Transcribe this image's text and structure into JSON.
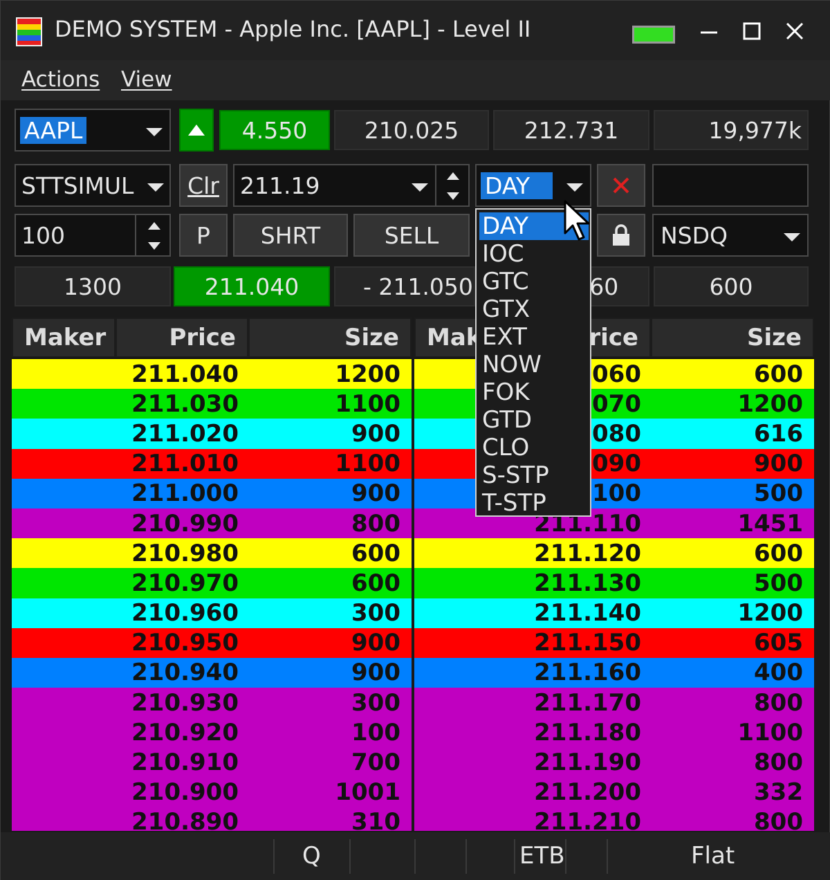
{
  "window": {
    "title": "DEMO SYSTEM - Apple Inc. [AAPL] - Level II"
  },
  "menu": {
    "actions": "Actions",
    "view": "View"
  },
  "row1": {
    "symbol": "AAPL",
    "change": "4.550",
    "bid_price": "210.025",
    "ask_price": "212.731",
    "volume": "19,977k"
  },
  "row2": {
    "account": "STTSIMUL",
    "clr_label": "Clr",
    "price": "211.19",
    "tif": "DAY"
  },
  "row3": {
    "quantity": "100",
    "p_label": "P",
    "short_label": "SHRT",
    "sell_label": "SELL",
    "route": "NSDQ"
  },
  "row4": {
    "bid_size": "1300",
    "bid": "211.040",
    "spread": "- 211.050",
    "ask": "211.060",
    "ask_size": "600"
  },
  "tif_options": [
    "DAY",
    "IOC",
    "GTC",
    "GTX",
    "EXT",
    "NOW",
    "FOK",
    "GTD",
    "CLO",
    "S-STP",
    "T-STP"
  ],
  "bid_table": {
    "headers": {
      "maker": "Maker",
      "price": "Price",
      "size": "Size"
    },
    "rows": [
      {
        "price": "211.040",
        "size": "1200",
        "color": "#ffff00"
      },
      {
        "price": "211.030",
        "size": "1100",
        "color": "#00e600"
      },
      {
        "price": "211.020",
        "size": "900",
        "color": "#00ffff"
      },
      {
        "price": "211.010",
        "size": "1100",
        "color": "#ff0000"
      },
      {
        "price": "211.000",
        "size": "900",
        "color": "#0080ff"
      },
      {
        "price": "210.990",
        "size": "800",
        "color": "#c000c0"
      },
      {
        "price": "210.980",
        "size": "600",
        "color": "#ffff00"
      },
      {
        "price": "210.970",
        "size": "600",
        "color": "#00e600"
      },
      {
        "price": "210.960",
        "size": "300",
        "color": "#00ffff"
      },
      {
        "price": "210.950",
        "size": "900",
        "color": "#ff0000"
      },
      {
        "price": "210.940",
        "size": "900",
        "color": "#0080ff"
      },
      {
        "price": "210.930",
        "size": "300",
        "color": "#c000c0"
      },
      {
        "price": "210.920",
        "size": "100",
        "color": "#c000c0"
      },
      {
        "price": "210.910",
        "size": "700",
        "color": "#c000c0"
      },
      {
        "price": "210.900",
        "size": "1001",
        "color": "#c000c0"
      },
      {
        "price": "210.890",
        "size": "310",
        "color": "#c000c0"
      }
    ]
  },
  "ask_table": {
    "headers": {
      "maker": "Maker",
      "price": "Price",
      "size": "Size"
    },
    "rows": [
      {
        "price": "211.060",
        "size": "600",
        "color": "#ffff00"
      },
      {
        "price": "211.070",
        "size": "1200",
        "color": "#00e600"
      },
      {
        "price": "211.080",
        "size": "616",
        "color": "#00ffff"
      },
      {
        "price": "211.090",
        "size": "900",
        "color": "#ff0000"
      },
      {
        "price": "211.100",
        "size": "500",
        "color": "#0080ff"
      },
      {
        "price": "211.110",
        "size": "1451",
        "color": "#c000c0"
      },
      {
        "price": "211.120",
        "size": "600",
        "color": "#ffff00"
      },
      {
        "price": "211.130",
        "size": "500",
        "color": "#00e600"
      },
      {
        "price": "211.140",
        "size": "1200",
        "color": "#00ffff"
      },
      {
        "price": "211.150",
        "size": "605",
        "color": "#ff0000"
      },
      {
        "price": "211.160",
        "size": "400",
        "color": "#0080ff"
      },
      {
        "price": "211.170",
        "size": "800",
        "color": "#c000c0"
      },
      {
        "price": "211.180",
        "size": "1100",
        "color": "#c000c0"
      },
      {
        "price": "211.190",
        "size": "800",
        "color": "#c000c0"
      },
      {
        "price": "211.200",
        "size": "332",
        "color": "#c000c0"
      },
      {
        "price": "211.210",
        "size": "800",
        "color": "#c000c0"
      }
    ]
  },
  "status": {
    "q": "Q",
    "etb": "ETB",
    "position": "Flat"
  },
  "colors": {
    "up_green": "#009900",
    "led_green": "#33dd22",
    "highlight": "#1976d8",
    "cancel_red": "#e02020"
  },
  "icons": [
    "app-icon",
    "minimize-icon",
    "maximize-icon",
    "close-icon",
    "up-arrow-icon",
    "cancel-x-icon",
    "lock-icon",
    "mouse-cursor-icon"
  ]
}
